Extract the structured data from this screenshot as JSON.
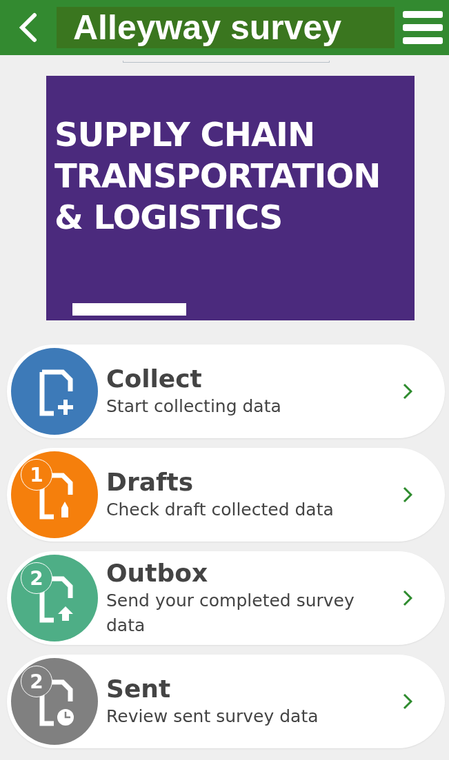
{
  "header": {
    "title": "Alleyway survey"
  },
  "banner": {
    "lines": [
      "SUPPLY CHAIN",
      "TRANSPORTATION",
      "& LOGISTICS"
    ]
  },
  "menu": [
    {
      "kind": "collect",
      "title": "Collect",
      "subtitle": "Start collecting data",
      "color": "#3d7ab8"
    },
    {
      "kind": "drafts",
      "title": "Drafts",
      "subtitle": "Check draft collected data",
      "color": "#f57f0c",
      "count": "1"
    },
    {
      "kind": "outbox",
      "title": "Outbox",
      "subtitle": "Send your completed survey data",
      "color": "#4eae86",
      "count": "2"
    },
    {
      "kind": "sent",
      "title": "Sent",
      "subtitle": "Review sent survey data",
      "color": "#808080",
      "count": "2"
    }
  ]
}
